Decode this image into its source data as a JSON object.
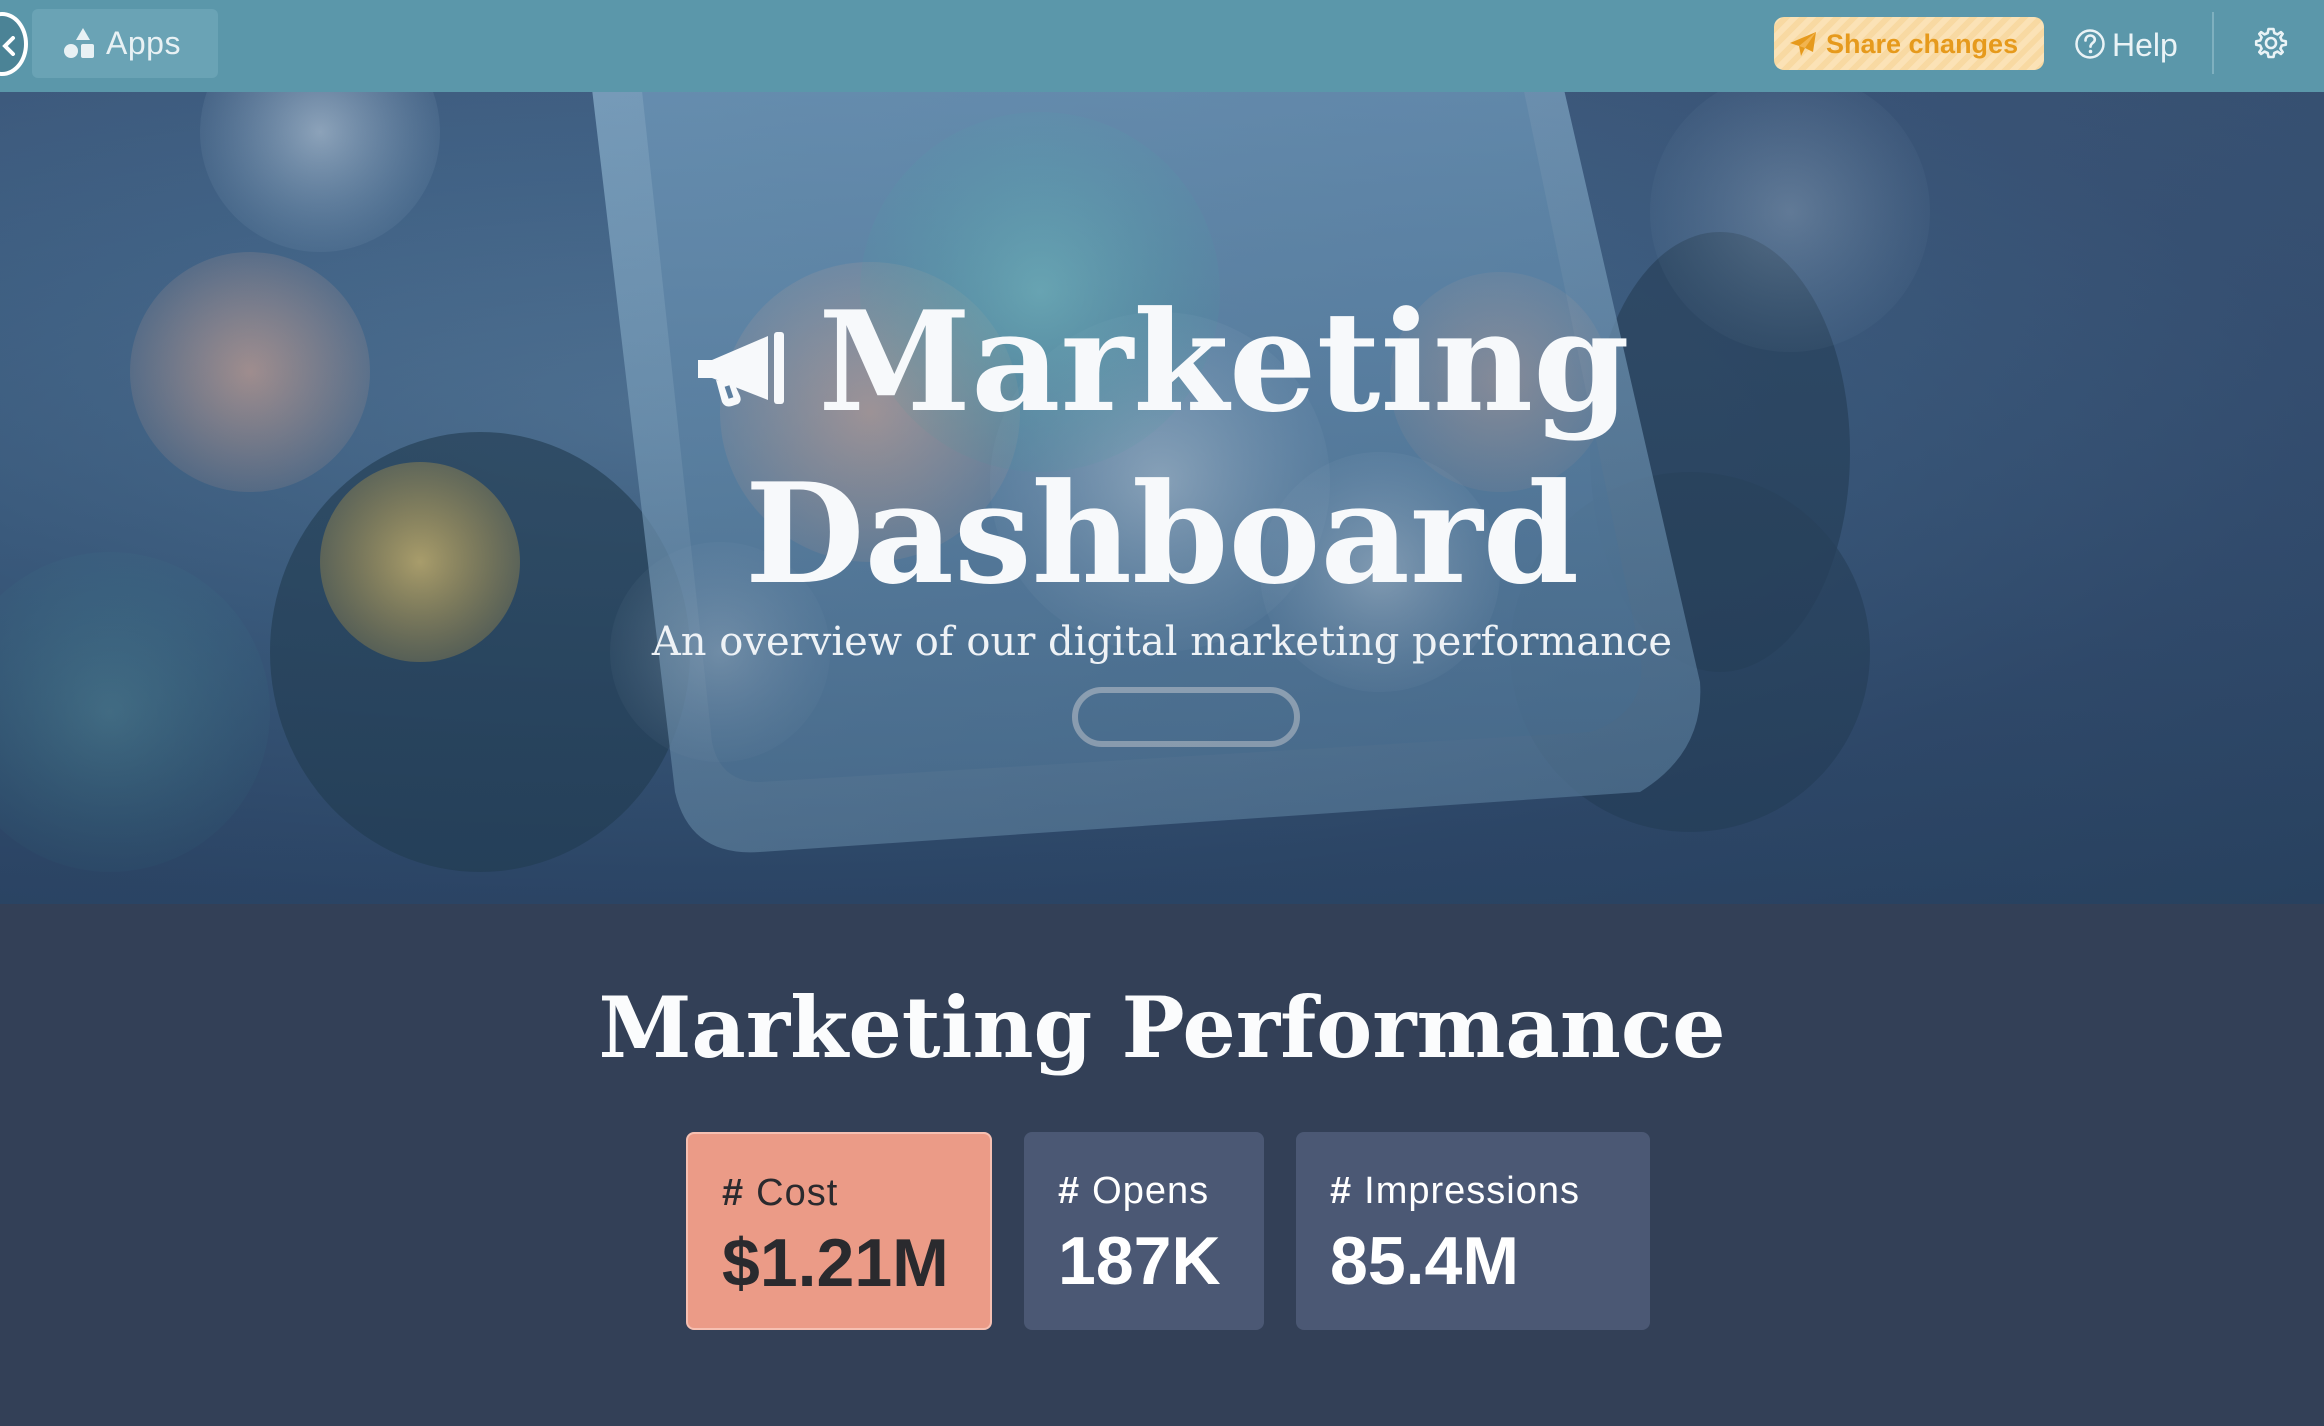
{
  "topbar": {
    "apps_label": "Apps",
    "share_label": "Share changes",
    "help_label": "Help",
    "icons": {
      "back": "chevron-left-icon",
      "apps": "shapes-icon",
      "share": "paper-plane-icon",
      "help": "question-circle-icon",
      "settings": "gear-icon"
    },
    "colors": {
      "bar": "#5b97aa",
      "share_text": "#e69a1c",
      "share_bg": "#fbe2b6"
    }
  },
  "hero": {
    "title_line1": "Marketing",
    "title_line2": "Dashboard",
    "subtitle": "An overview of our digital marketing performance",
    "icon": "megaphone-icon"
  },
  "performance": {
    "title": "Marketing Performance",
    "cards": [
      {
        "label": "Cost",
        "value": "$1.21M",
        "color": "#eb9b87"
      },
      {
        "label": "Opens",
        "value": "187K",
        "color": "#4b5874"
      },
      {
        "label": "Impressions",
        "value": "85.4M",
        "color": "#4b5874"
      }
    ],
    "hash": "#"
  }
}
